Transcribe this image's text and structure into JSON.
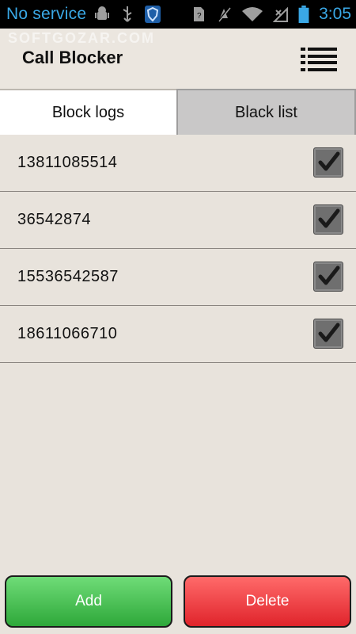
{
  "status_bar": {
    "service_text": "No service",
    "time": "3:05",
    "icons": [
      "android-debug-icon",
      "usb-icon",
      "shield-icon",
      "sim-icon",
      "mute-icon",
      "wifi-icon",
      "no-signal-icon",
      "battery-icon"
    ]
  },
  "watermark": "SOFTGOZAR.COM",
  "app": {
    "title": "Call Blocker"
  },
  "tabs": [
    {
      "label": "Block logs",
      "active": true
    },
    {
      "label": "Black list",
      "active": false
    }
  ],
  "numbers": [
    {
      "number": "13811085514",
      "checked": true
    },
    {
      "number": "36542874",
      "checked": true
    },
    {
      "number": "15536542587",
      "checked": true
    },
    {
      "number": "18611066710",
      "checked": true
    }
  ],
  "buttons": {
    "add_label": "Add",
    "delete_label": "Delete"
  },
  "colors": {
    "status_text": "#3aa8e6",
    "add_green": "#2ea83a",
    "delete_red": "#e0242b"
  }
}
